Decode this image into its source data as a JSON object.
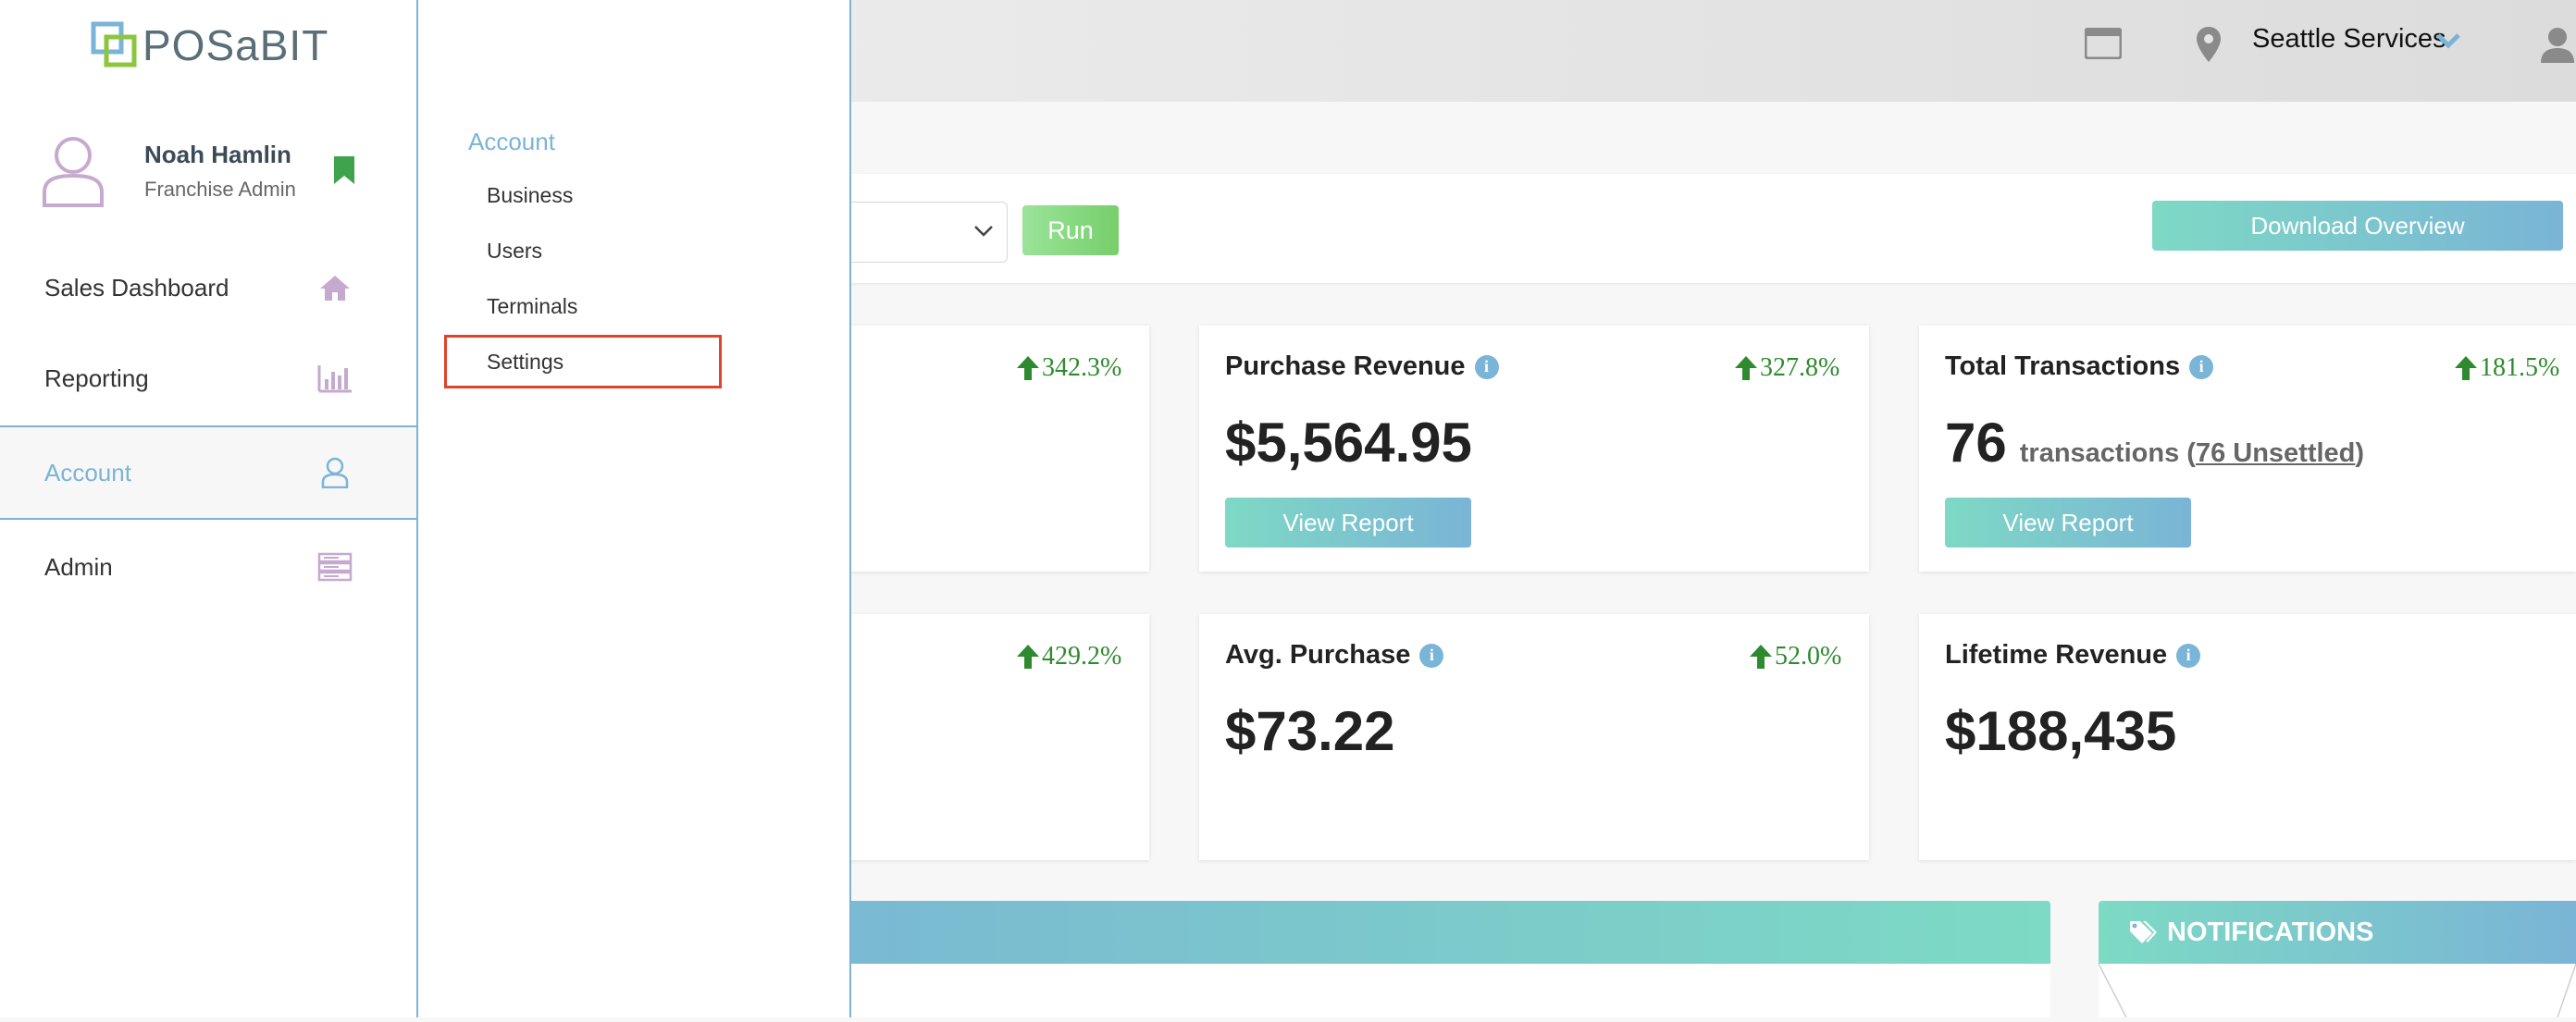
{
  "topbar": {
    "location": "Seattle Services",
    "icons": [
      "window-icon",
      "location-pin-icon",
      "chevron-down-icon",
      "user-icon"
    ]
  },
  "sidebar": {
    "logo_text": "POSaBIT",
    "profile": {
      "name": "Noah Hamlin",
      "role": "Franchise Admin"
    },
    "items": [
      {
        "label": "Sales Dashboard",
        "icon": "home-icon"
      },
      {
        "label": "Reporting",
        "icon": "bar-chart-icon"
      },
      {
        "label": "Account",
        "icon": "user-outline-icon",
        "active": true
      },
      {
        "label": "Admin",
        "icon": "server-icon"
      }
    ]
  },
  "submenu": {
    "heading": "Account",
    "items": [
      {
        "label": "Business"
      },
      {
        "label": "Users"
      },
      {
        "label": "Terminals"
      },
      {
        "label": "Settings",
        "highlighted": true
      }
    ]
  },
  "toolbar": {
    "run_label": "Run",
    "download_label": "Download Overview"
  },
  "cards": {
    "card1": {
      "change": "342.3%"
    },
    "purchase_revenue": {
      "title": "Purchase Revenue",
      "value": "$5,564.95",
      "change": "327.8%",
      "button": "View Report"
    },
    "total_transactions": {
      "title": "Total Transactions",
      "value": "76",
      "label": "transactions",
      "open_paren": "(",
      "unsettled": "76 Unsettled",
      "close_paren": ")",
      "change": "181.5%",
      "button": "View Report"
    },
    "card4": {
      "change": "429.2%"
    },
    "avg_purchase": {
      "title": "Avg. Purchase",
      "value": "$73.22",
      "change": "52.0%"
    },
    "lifetime_revenue": {
      "title": "Lifetime Revenue",
      "value": "$188,435"
    }
  },
  "notifications": {
    "title": "NOTIFICATIONS"
  },
  "colors": {
    "accent": "#7ab4d6",
    "teal": "#7ddac4",
    "positive": "#2f8a2f",
    "run_green": "#76cf6b",
    "highlight": "#e0432b"
  }
}
